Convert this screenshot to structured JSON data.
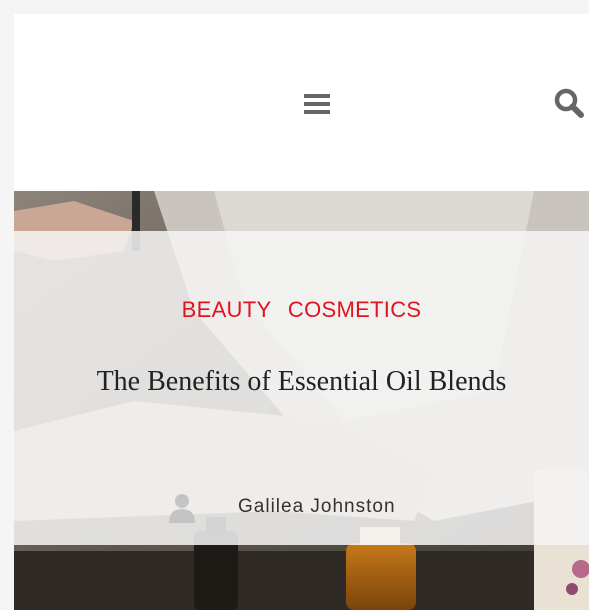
{
  "header": {
    "menu_icon": "hamburger-menu-icon",
    "search_icon": "search-icon"
  },
  "post": {
    "categories": [
      "BEAUTY",
      "COSMETICS"
    ],
    "title": "The Benefits of Essential Oil Blends",
    "author": "Galilea Johnston",
    "author_icon": "user-icon"
  },
  "colors": {
    "category": "#e0141e",
    "icon": "#666666",
    "overlay": "#f4f4f4"
  }
}
